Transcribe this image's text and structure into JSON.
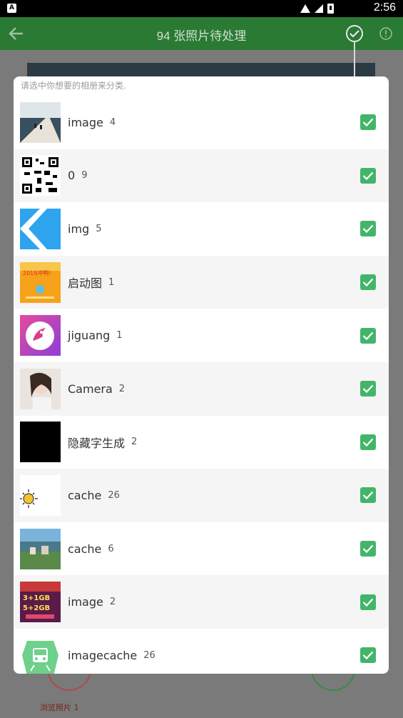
{
  "status_bar": {
    "time": "2:56",
    "app_icon_letter": "A"
  },
  "toolbar": {
    "title": "94 张照片待处理",
    "back_icon": "arrow-left-icon",
    "confirm_icon": "check-circle-icon",
    "info_icon": "info-icon"
  },
  "dialog": {
    "hint": "请选中你想要的相册来分类.",
    "albums": [
      {
        "name": "image",
        "count": "4",
        "checked": true,
        "thumb": "thumb-image-1"
      },
      {
        "name": "0",
        "count": "9",
        "checked": true,
        "thumb": "thumb-qrcode"
      },
      {
        "name": "img",
        "count": "5",
        "checked": true,
        "thumb": "thumb-img"
      },
      {
        "name": "启动图",
        "count": "1",
        "checked": true,
        "thumb": "thumb-splash"
      },
      {
        "name": "jiguang",
        "count": "1",
        "checked": true,
        "thumb": "thumb-jiguang"
      },
      {
        "name": "Camera",
        "count": "2",
        "checked": true,
        "thumb": "thumb-camera"
      },
      {
        "name": "隐藏字生成",
        "count": "2",
        "checked": true,
        "thumb": "thumb-black"
      },
      {
        "name": "cache",
        "count": "26",
        "checked": true,
        "thumb": "thumb-sun"
      },
      {
        "name": "cache",
        "count": "6",
        "checked": true,
        "thumb": "thumb-landscape"
      },
      {
        "name": "image",
        "count": "2",
        "checked": true,
        "thumb": "thumb-promo"
      },
      {
        "name": "imagecache",
        "count": "26",
        "checked": true,
        "thumb": "thumb-train"
      }
    ]
  },
  "background": {
    "caption": "浏览照片 1"
  },
  "colors": {
    "toolbar": "#2a7a34",
    "check": "#43b56a",
    "dialog_bg": "#ffffff",
    "row_alt": "#f5f5f5"
  }
}
